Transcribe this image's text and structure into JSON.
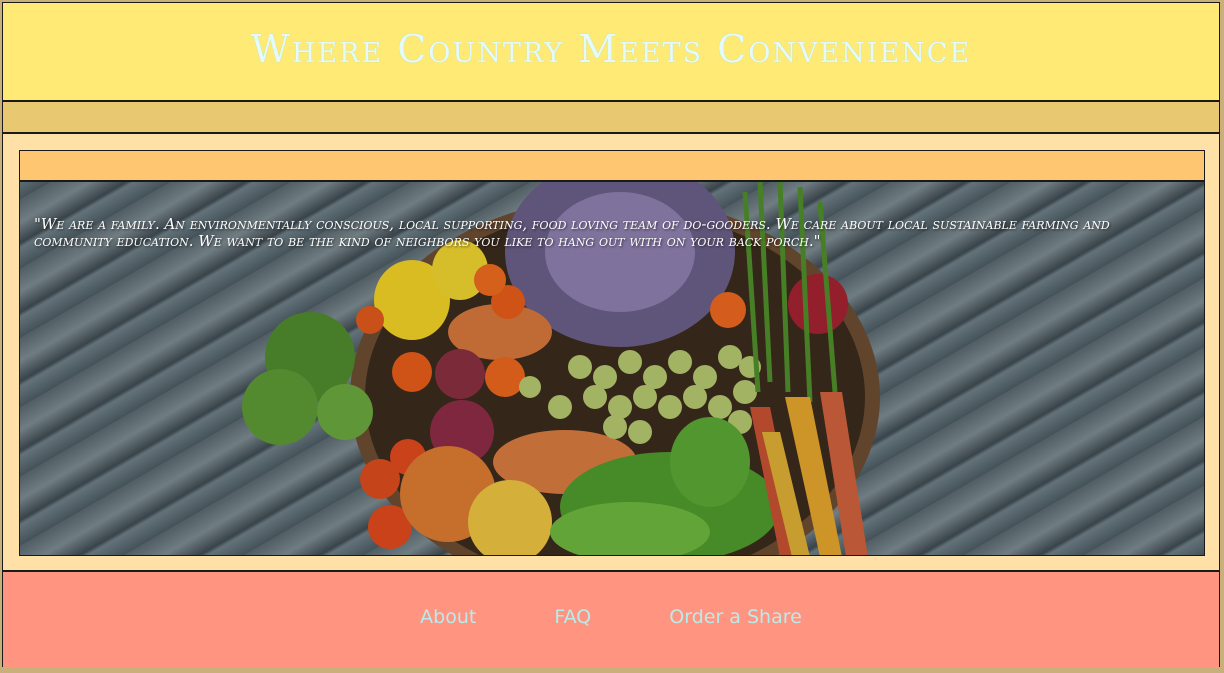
{
  "header": {
    "title": "Where Country Meets Convenience"
  },
  "hero": {
    "quote": "\"We are a family. An environmentally conscious, local supporting, food loving team of do-gooders. We care about local sustainable farming and community education. We want to be the kind of neighbors you like to hang out with on your back porch.\""
  },
  "nav": {
    "items": [
      {
        "label": "About"
      },
      {
        "label": "FAQ"
      },
      {
        "label": "Order a Share"
      }
    ]
  },
  "colors": {
    "header": "#ffea76",
    "subbar": "#e8c870",
    "content": "#ffe1a8",
    "inner_bar": "#ffc672",
    "footer": "#ff9480",
    "title_text": "#e4fbf9",
    "nav_text": "#b8ecec"
  }
}
